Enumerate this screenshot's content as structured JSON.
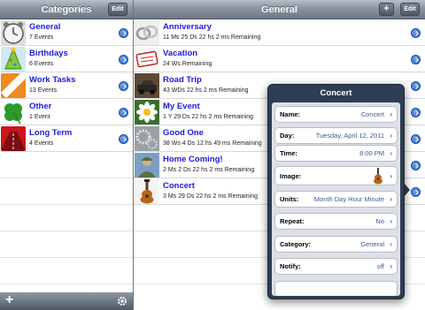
{
  "left_nav": {
    "title": "Categories",
    "edit_label": "Edit"
  },
  "right_nav": {
    "title": "General",
    "add_label": "+",
    "edit_label": "Edit"
  },
  "categories": [
    {
      "name": "General",
      "count": "7 Events",
      "icon": "clock-icon"
    },
    {
      "name": "Birthdays",
      "count": "6 Events",
      "icon": "party-hat-icon"
    },
    {
      "name": "Work Tasks",
      "count": "13 Events",
      "icon": "work-tasks-icon"
    },
    {
      "name": "Other",
      "count": "1 Event",
      "icon": "clover-icon"
    },
    {
      "name": "Long Term",
      "count": "4 Events",
      "icon": "road-icon"
    }
  ],
  "events": [
    {
      "name": "Anniversary",
      "time": "11 Ms 25 Ds 22 hs 2 ms Remaining",
      "icon": "rings-icon"
    },
    {
      "name": "Vacation",
      "time": "24 Ws Remaining",
      "icon": "vacation-sign-icon"
    },
    {
      "name": "Road Trip",
      "time": "43 WDs 22 hs 2 ms Remaining",
      "icon": "car-icon"
    },
    {
      "name": "My Event",
      "time": "1 Y 29 Ds 22 hs 2 ms Remaining",
      "icon": "flower-icon"
    },
    {
      "name": "Good One",
      "time": "38 Ws 4 Ds 12 hs 49 ms Remaining",
      "icon": "gears-icon"
    },
    {
      "name": "Home Coming!",
      "time": "2 Ms 2 Ds 22 hs 2 ms Remaining",
      "icon": "soldier-icon"
    },
    {
      "name": "Concert",
      "time": "3 Ms 29 Ds 22 hs 2 ms Remaining",
      "icon": "guitar-icon"
    }
  ],
  "popover": {
    "title": "Concert",
    "fields": [
      {
        "label": "Name:",
        "value": "Concert"
      },
      {
        "label": "Day:",
        "value": "Tuesday, April 12, 2011"
      },
      {
        "label": "Time:",
        "value": "8:00 PM"
      },
      {
        "label": "Image:",
        "value": ""
      },
      {
        "label": "Units:",
        "value": "Month Day Hour Minute"
      },
      {
        "label": "Repeat:",
        "value": "No"
      },
      {
        "label": "Category:",
        "value": "General"
      },
      {
        "label": "Notify:",
        "value": "off"
      },
      {
        "label": "",
        "value": ""
      }
    ]
  },
  "toolbar": {
    "add_label": "+",
    "settings_icon": "gear-icon"
  }
}
